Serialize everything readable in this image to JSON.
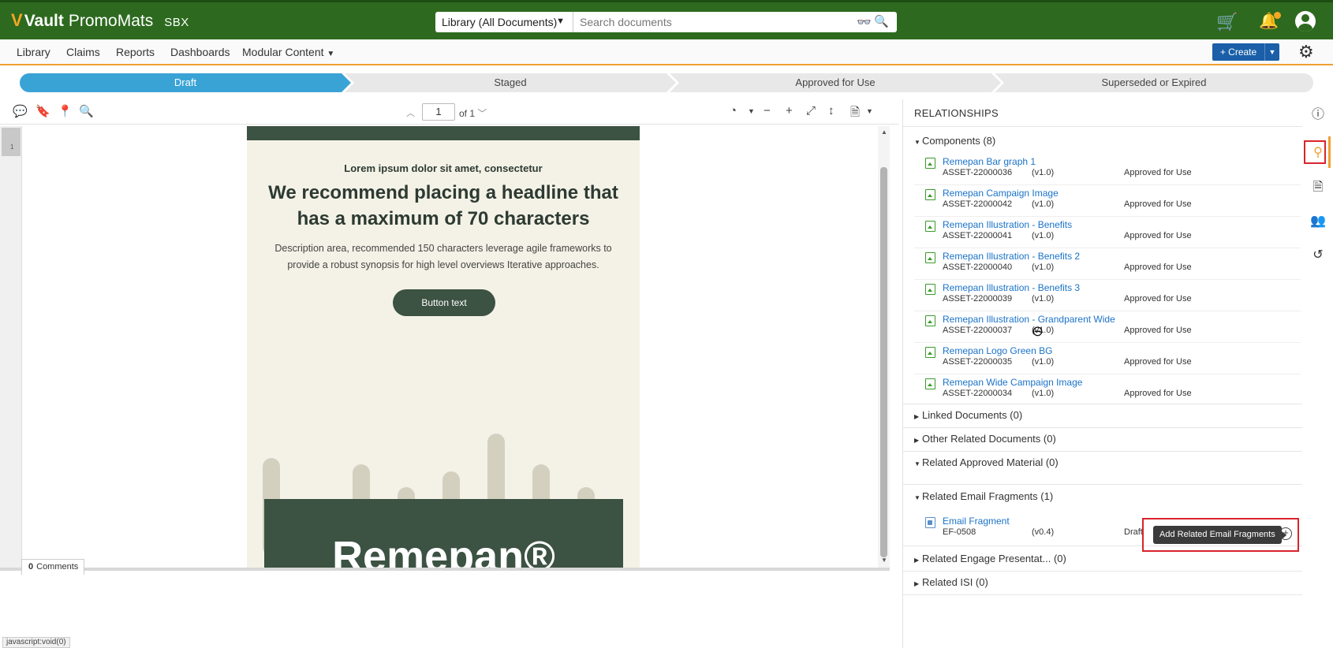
{
  "header": {
    "logo_v": "V",
    "logo_brand": "Vault",
    "logo_product": "PromoMats",
    "env": "SBX",
    "library_select": "Library (All Documents)",
    "search_placeholder": "Search documents"
  },
  "nav": {
    "items": [
      "Library",
      "Claims",
      "Reports",
      "Dashboards",
      "Modular Content"
    ],
    "create_label": "+ Create"
  },
  "lifecycle": {
    "stages": [
      "Draft",
      "Staged",
      "Approved for Use",
      "Superseded or Expired"
    ],
    "active": "Draft"
  },
  "viewer": {
    "page": "1",
    "of": "of 1",
    "thumb_page": "1",
    "comments_count": "0",
    "comments_label": "Comments",
    "status_bar": "javascript:void(0)"
  },
  "document": {
    "eyebrow": "Lorem ipsum dolor sit amet, consectetur",
    "headline": "We recommend placing a headline that has a maximum of 70 characters",
    "description": "Description area, recommended 150 characters leverage agile frameworks to provide a robust synopsis for high level overviews Iterative approaches.",
    "button": "Button text",
    "bars": [
      {
        "value": 512,
        "highlight": false
      },
      {
        "value": 240,
        "highlight": true
      },
      {
        "value": 480,
        "highlight": false
      },
      {
        "value": 360,
        "highlight": false
      },
      {
        "value": 440,
        "highlight": false
      },
      {
        "value": 640,
        "highlight": false
      },
      {
        "value": 480,
        "highlight": false
      },
      {
        "value": 360,
        "highlight": false
      }
    ],
    "brand": "Remepan®"
  },
  "relationships": {
    "title": "RELATIONSHIPS",
    "components_header": "Components (8)",
    "components": [
      {
        "name": "Remepan Bar graph 1",
        "id": "ASSET-22000036",
        "version": "(v1.0)",
        "status": "Approved for Use"
      },
      {
        "name": "Remepan Campaign Image",
        "id": "ASSET-22000042",
        "version": "(v1.0)",
        "status": "Approved for Use"
      },
      {
        "name": "Remepan Illustration - Benefits",
        "id": "ASSET-22000041",
        "version": "(v1.0)",
        "status": "Approved for Use"
      },
      {
        "name": "Remepan Illustration - Benefits 2",
        "id": "ASSET-22000040",
        "version": "(v1.0)",
        "status": "Approved for Use"
      },
      {
        "name": "Remepan Illustration - Benefits 3",
        "id": "ASSET-22000039",
        "version": "(v1.0)",
        "status": "Approved for Use"
      },
      {
        "name": "Remepan Illustration - Grandparent Wide",
        "id": "ASSET-22000037",
        "version": "(v1.0)",
        "status": "Approved for Use"
      },
      {
        "name": "Remepan Logo Green BG",
        "id": "ASSET-22000035",
        "version": "(v1.0)",
        "status": "Approved for Use"
      },
      {
        "name": "Remepan Wide Campaign Image",
        "id": "ASSET-22000034",
        "version": "(v1.0)",
        "status": "Approved for Use"
      }
    ],
    "linked_documents": "Linked Documents (0)",
    "other_related": "Other Related Documents (0)",
    "related_approved": "Related Approved Material (0)",
    "related_email_header": "Related Email Fragments (1)",
    "email_fragments": [
      {
        "name": "Email Fragment",
        "id": "EF-0508",
        "version": "(v0.4)",
        "status": "Draft"
      }
    ],
    "related_engage": "Related Engage Presentat...  (0)",
    "related_isi": "Related ISI (0)",
    "add_tooltip": "Add Related Email Fragments"
  },
  "colors": {
    "header_green": "#2d6a1f",
    "accent_orange": "#f0a030",
    "lifecycle_active": "#3aa3d6",
    "link_blue": "#1a73c8",
    "highlight_red": "#d9242c",
    "email_dark_green": "#3c5243"
  }
}
